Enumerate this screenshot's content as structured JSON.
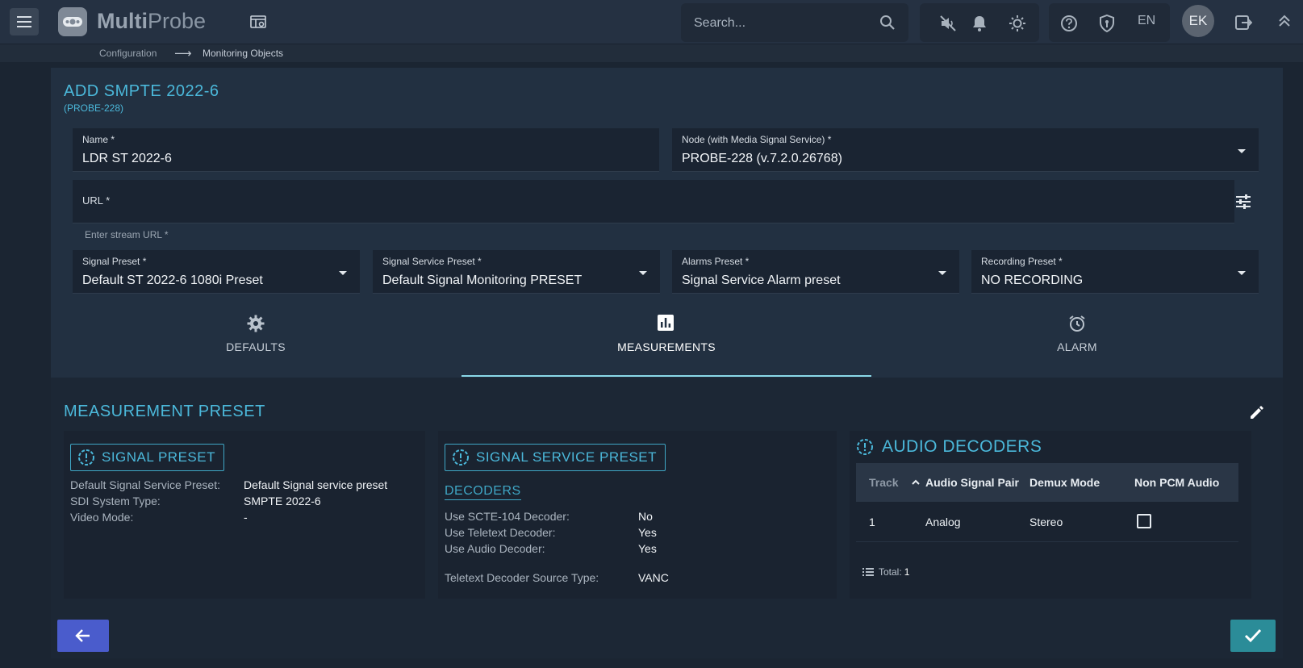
{
  "app": {
    "brand_bold": "Multi",
    "brand_light": "Probe"
  },
  "header": {
    "search_placeholder": "Search...",
    "language": "EN",
    "user_initials": "EK",
    "icons": [
      "menu-icon",
      "map-icon",
      "search-icon",
      "mute-icon",
      "bell-icon",
      "brightness-icon",
      "help-icon",
      "shield-icon",
      "logout-icon",
      "chevron-up-icon"
    ]
  },
  "breadcrumb": {
    "items": [
      "Configuration",
      "Monitoring Objects"
    ],
    "separator": "⟶"
  },
  "form": {
    "title": "ADD SMPTE 2022-6",
    "subtitle": "(PROBE-228)",
    "name": {
      "label": "Name *",
      "value": "LDR ST 2022-6"
    },
    "node": {
      "label": "Node (with Media Signal Service) *",
      "value": "PROBE-228 (v.7.2.0.26768)"
    },
    "url": {
      "label": "URL *",
      "value": "",
      "hint": "Enter stream URL *"
    },
    "presets": [
      {
        "label": "Signal Preset *",
        "value": "Default ST 2022-6 1080i Preset"
      },
      {
        "label": "Signal Service Preset *",
        "value": "Default Signal Monitoring PRESET"
      },
      {
        "label": "Alarms Preset *",
        "value": "Signal Service Alarm preset"
      },
      {
        "label": "Recording Preset *",
        "value": "NO RECORDING"
      }
    ]
  },
  "tabs": [
    {
      "label": "DEFAULTS",
      "icon": "gear-icon",
      "active": false
    },
    {
      "label": "MEASUREMENTS",
      "icon": "chart-icon",
      "active": true
    },
    {
      "label": "ALARM",
      "icon": "alarm-clock-icon",
      "active": false
    }
  ],
  "measurement": {
    "title": "MEASUREMENT PRESET",
    "signal_preset": {
      "title": "SIGNAL PRESET",
      "rows": [
        {
          "key": "Default Signal Service Preset:",
          "value": "Default Signal service preset"
        },
        {
          "key": "SDI System Type:",
          "value": "SMPTE 2022-6"
        },
        {
          "key": "Video Mode:",
          "value": "-"
        }
      ]
    },
    "signal_service_preset": {
      "title": "SIGNAL SERVICE PRESET",
      "section": "DECODERS",
      "rows": [
        {
          "key": "Use SCTE-104 Decoder:",
          "value": "No"
        },
        {
          "key": "Use Teletext Decoder:",
          "value": "Yes"
        },
        {
          "key": "Use Audio Decoder:",
          "value": "Yes"
        },
        {
          "key": "Teletext Decoder Source Type:",
          "value": "VANC"
        }
      ]
    },
    "audio_decoders": {
      "title": "AUDIO DECODERS",
      "columns": [
        "Track",
        "Audio Signal Pair",
        "Demux Mode",
        "Non PCM Audio"
      ],
      "rows": [
        {
          "track": "1",
          "pair": "Analog",
          "demux": "Stereo",
          "non_pcm": false
        }
      ],
      "total_label": "Total:",
      "total": "1"
    }
  },
  "colors": {
    "accent": "#4bb8da",
    "primary_button": "#4a5ccc",
    "confirm_button": "#2b8c98"
  }
}
